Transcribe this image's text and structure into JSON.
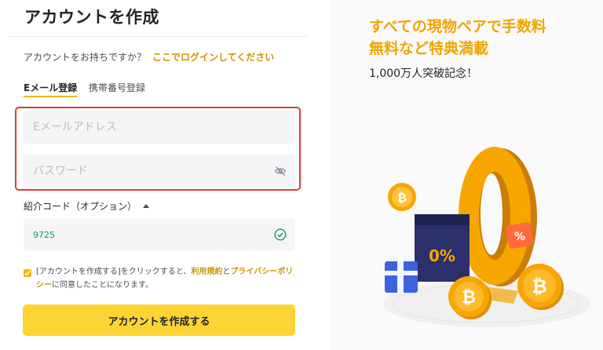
{
  "form": {
    "title": "アカウントを作成",
    "login_prompt": "アカウントをお持ちですか？",
    "login_link": "ここでログインしてください",
    "tabs": [
      {
        "label": "Eメール登録",
        "active": true
      },
      {
        "label": "携帯番号登録",
        "active": false
      }
    ],
    "email_placeholder": "Eメールアドレス",
    "password_placeholder": "パスワード",
    "referral_label": "紹介コード（オプション）",
    "referral_value": "9725",
    "terms_prefix": "[アカウントを作成する]をクリックすると、",
    "terms_link_1": "利用規約",
    "terms_and": "と",
    "terms_link_2": "プライバシーポリシー",
    "terms_suffix": "に同意したことになります。",
    "submit_label": "アカウントを作成する",
    "terms_checked": true
  },
  "promo": {
    "heading_line1": "すべての現物ペアで手数料",
    "heading_line2": "無料など特典満載",
    "subheading": "1,000万人突破記念！",
    "badge_zero": "0",
    "ticket_text": "0%",
    "tag_text": "%",
    "accent_color": "#f0b90b"
  },
  "icons": {
    "eye": "eye-slash-icon",
    "check": "check-circle-icon",
    "caret": "caret-up-icon"
  }
}
